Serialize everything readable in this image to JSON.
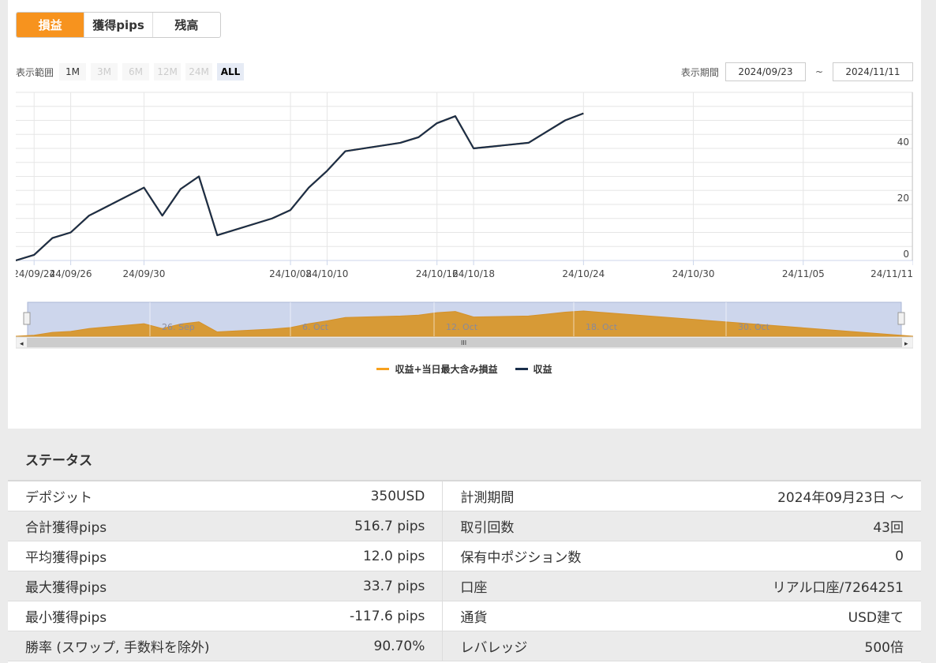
{
  "tabs": [
    {
      "label": "損益",
      "active": true
    },
    {
      "label": "獲得pips",
      "active": false
    },
    {
      "label": "残高",
      "active": false
    }
  ],
  "range": {
    "label": "表示範囲",
    "buttons": [
      {
        "label": "1M",
        "state": "enabled"
      },
      {
        "label": "3M",
        "state": "disabled"
      },
      {
        "label": "6M",
        "state": "disabled"
      },
      {
        "label": "12M",
        "state": "disabled"
      },
      {
        "label": "24M",
        "state": "disabled"
      },
      {
        "label": "ALL",
        "state": "selected"
      }
    ]
  },
  "period": {
    "label": "表示期間",
    "from": "2024/09/23",
    "separator": "~",
    "to": "2024/11/11"
  },
  "chart_data": {
    "type": "line",
    "series": [
      {
        "name": "収益+当日最大含み損益",
        "color": "#f7a11e",
        "values": [
          0,
          2,
          8,
          10,
          16,
          26,
          16,
          25.5,
          30,
          9,
          15,
          18,
          26,
          32,
          39,
          42,
          44,
          49,
          51.5,
          40,
          42,
          46,
          50,
          52.5
        ]
      },
      {
        "name": "収益",
        "color": "#1a2e4a",
        "values": [
          0,
          2,
          8,
          10,
          16,
          26,
          16,
          25.5,
          30,
          9,
          15,
          18,
          26,
          32,
          39,
          42,
          44,
          49,
          51.5,
          40,
          42,
          46,
          50,
          52.5
        ]
      }
    ],
    "x": [
      "2024-09-23",
      "2024-09-24",
      "2024-09-25",
      "2024-09-26",
      "2024-09-27",
      "2024-09-30",
      "2024-10-01",
      "2024-10-02",
      "2024-10-03",
      "2024-10-04",
      "2024-10-07",
      "2024-10-08",
      "2024-10-09",
      "2024-10-10",
      "2024-10-11",
      "2024-10-14",
      "2024-10-15",
      "2024-10-16",
      "2024-10-17",
      "2024-10-18",
      "2024-10-21",
      "2024-10-22",
      "2024-10-23",
      "2024-10-24"
    ],
    "x_tick_labels": [
      "24/09/24",
      "24/09/26",
      "24/09/30",
      "24/10/08",
      "24/10/10",
      "24/10/16",
      "24/10/18",
      "24/10/24",
      "24/10/30",
      "24/11/05",
      "24/11/11"
    ],
    "y_ticks": [
      0,
      20,
      40
    ],
    "ylim": [
      0,
      60
    ],
    "navigator_labels": [
      "26. Sep",
      "6. Oct",
      "12. Oct",
      "18. Oct",
      "30. Oct"
    ],
    "grid": true,
    "legend_position": "bottom"
  },
  "status": {
    "title": "ステータス",
    "rows": [
      {
        "k1": "デポジット",
        "v1": "350USD",
        "k2": "計測期間",
        "v2": "2024年09月23日 ～"
      },
      {
        "k1": "合計獲得pips",
        "v1": "516.7 pips",
        "k2": "取引回数",
        "v2": "43回"
      },
      {
        "k1": "平均獲得pips",
        "v1": "12.0 pips",
        "k2": "保有中ポジション数",
        "v2": "0"
      },
      {
        "k1": "最大獲得pips",
        "v1": "33.7 pips",
        "k2": "口座",
        "v2": "リアル口座/7264251"
      },
      {
        "k1": "最小獲得pips",
        "v1": "-117.6 pips",
        "k2": "通貨",
        "v2": "USD建て"
      },
      {
        "k1": "勝率 (スワップ, 手数料を除外)",
        "v1": "90.70%",
        "k2": "レバレッジ",
        "v2": "500倍"
      }
    ]
  }
}
